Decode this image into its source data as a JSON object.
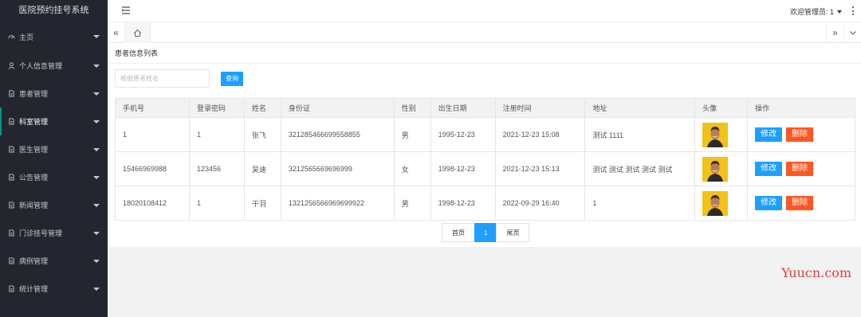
{
  "app": {
    "title": "医院预约挂号系统"
  },
  "sidebar": {
    "items": [
      {
        "label": "主页",
        "icon": "gauge-icon"
      },
      {
        "label": "个人信息管理",
        "icon": "user-icon"
      },
      {
        "label": "患者管理",
        "icon": "file-icon"
      },
      {
        "label": "科室管理",
        "icon": "file-icon"
      },
      {
        "label": "医生管理",
        "icon": "file-icon"
      },
      {
        "label": "公告管理",
        "icon": "file-icon"
      },
      {
        "label": "新闻管理",
        "icon": "file-icon"
      },
      {
        "label": "门诊挂号管理",
        "icon": "file-icon"
      },
      {
        "label": "病例管理",
        "icon": "file-icon"
      },
      {
        "label": "统计管理",
        "icon": "file-icon"
      }
    ]
  },
  "header": {
    "welcome": "欢迎管理员: 1"
  },
  "tabs": {
    "left_arrow": "«",
    "right_arrow": "»"
  },
  "panel": {
    "title": "患者信息列表"
  },
  "search": {
    "placeholder": "根据患者姓名",
    "button": "查询"
  },
  "table": {
    "headers": [
      "手机号",
      "登录密码",
      "姓名",
      "身份证",
      "性别",
      "出生日期",
      "注册时间",
      "地址",
      "头像",
      "操作"
    ],
    "rows": [
      [
        "1",
        "1",
        "张飞",
        "321285466699558855",
        "男",
        "1995-12-23",
        "2021-12-23 15:08",
        "测试 1111"
      ],
      [
        "15466969988",
        "123456",
        "吴迪",
        "3212565669696999",
        "女",
        "1998-12-23",
        "2021-12-23 15:13",
        "测试 测试 测试 测试 测试"
      ],
      [
        "18020108412",
        "1",
        "干羽",
        "1321256566969699922",
        "男",
        "1998-12-23",
        "2022-09-29 16:40",
        "1"
      ]
    ],
    "edit_label": "修改",
    "delete_label": "删除"
  },
  "pager": {
    "first": "首页",
    "current": "1",
    "last": "尾页"
  },
  "watermark": "Yuucn.com",
  "colors": {
    "sidebar": "#23262e",
    "primary": "#1e9fff",
    "danger": "#ff5722",
    "accent": "#009688"
  }
}
